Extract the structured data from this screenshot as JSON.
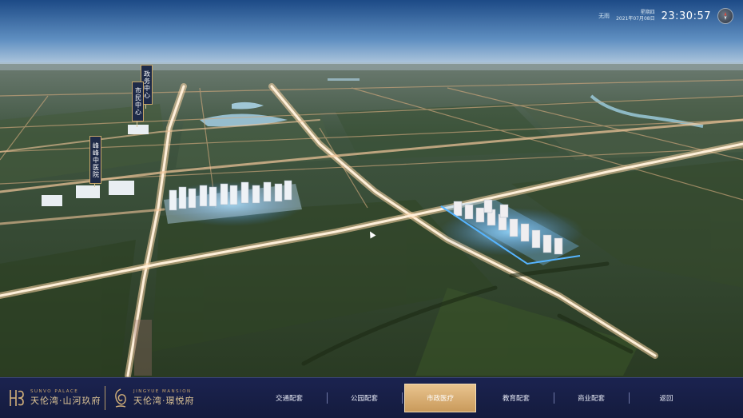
{
  "header": {
    "weather": "无雨",
    "weekday": "星期四",
    "date": "2021年07月08日",
    "time": "23:30:57"
  },
  "pois": [
    {
      "label": "政务中心"
    },
    {
      "label": "市民中心"
    },
    {
      "label": "峰峰中医院"
    }
  ],
  "brands": [
    {
      "en": "SUNVO PALACE",
      "cn": "天伦湾·山河玖府"
    },
    {
      "en": "JINGYUE MANSION",
      "cn": "天伦湾·璟悦府"
    }
  ],
  "nav": {
    "items": [
      {
        "label": "交通配套",
        "active": false
      },
      {
        "label": "公园配套",
        "active": false
      },
      {
        "label": "市政医疗",
        "active": true
      },
      {
        "label": "教育配套",
        "active": false
      },
      {
        "label": "商业配套",
        "active": false
      },
      {
        "label": "返回",
        "active": false
      }
    ]
  },
  "colors": {
    "nav_active": "#d6a96c",
    "bottom_bar": "#1b2350",
    "gold": "#d2b07a",
    "road_glow": "#ffd7a8"
  }
}
